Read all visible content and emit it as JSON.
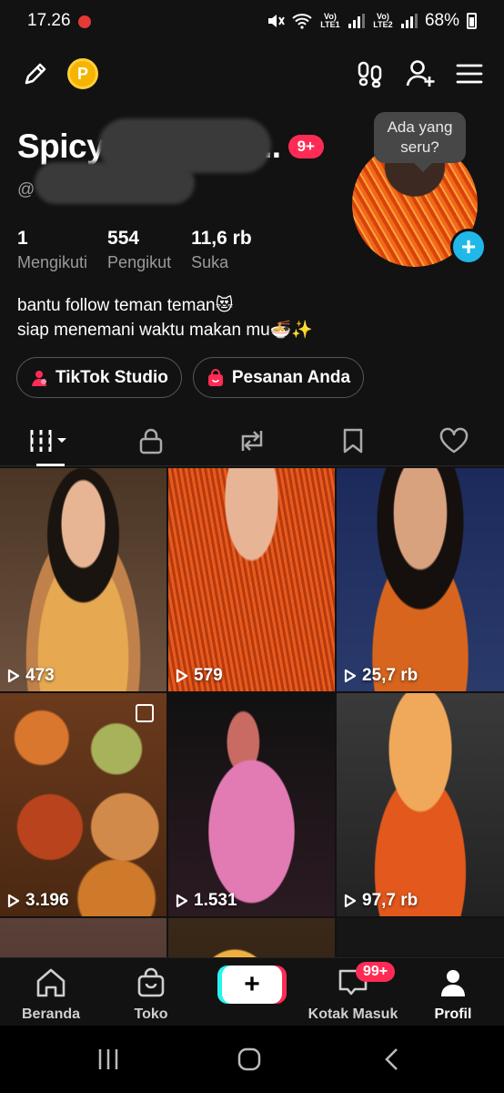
{
  "status_bar": {
    "time": "17.26",
    "sim1": "Vo) LTE1",
    "sim2": "Vo) LTE2",
    "battery": "68%"
  },
  "top_nav": {
    "coin_letter": "P"
  },
  "profile": {
    "display_name": "Spicy",
    "display_name_suffix": "...",
    "notification_badge": "9+",
    "handle_prefix": "@",
    "bubble_text": "Ada yang seru?",
    "avatar_plus": "+",
    "stats": [
      {
        "number": "1",
        "label": "Mengikuti"
      },
      {
        "number": "554",
        "label": "Pengikut"
      },
      {
        "number": "11,6 rb",
        "label": "Suka"
      }
    ],
    "bio_line1": "bantu follow teman teman😻",
    "bio_line2": "siap menemani waktu makan mu🍜✨",
    "buttons": [
      {
        "label": "TikTok Studio"
      },
      {
        "label": "Pesanan Anda"
      }
    ]
  },
  "videos": [
    {
      "views": "473"
    },
    {
      "views": "579"
    },
    {
      "views": "25,7 rb"
    },
    {
      "views": "3.196"
    },
    {
      "views": "1.531"
    },
    {
      "views": "97,7 rb"
    }
  ],
  "bottom_nav": {
    "home": "Beranda",
    "shop": "Toko",
    "create": "+",
    "inbox": "Kotak Masuk",
    "inbox_badge": "99+",
    "profile": "Profil"
  },
  "colors": {
    "accent_pink": "#fe2c55",
    "accent_cyan": "#25f4ee",
    "plus_blue": "#20b8e8",
    "coin": "#f5b400"
  }
}
